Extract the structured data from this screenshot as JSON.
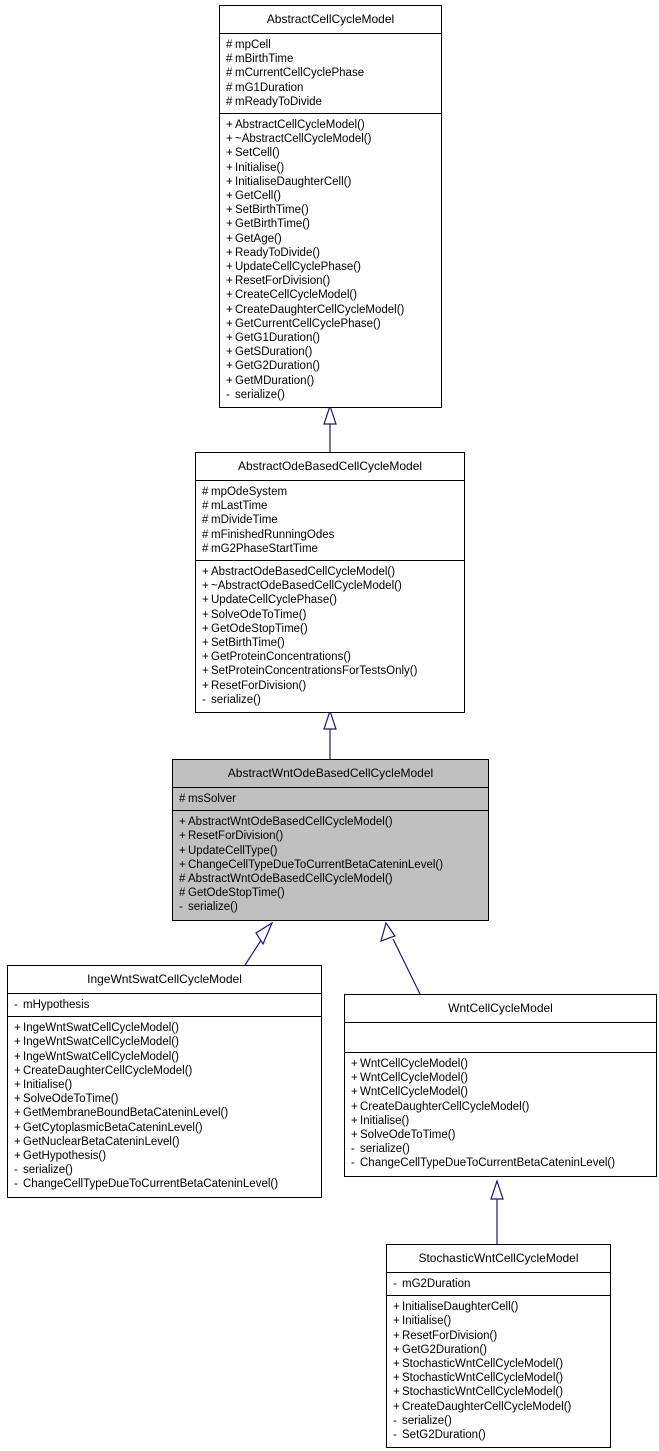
{
  "diagram": {
    "type": "uml-class-diagram",
    "title": "AbstractWntOdeBasedCellCycleModel inheritance diagram",
    "highlight_color": "#c0c0c0",
    "line_color": "#191970",
    "border_color": "#000000",
    "background": "#ffffff"
  },
  "classes": [
    {
      "id": "abstract-cell-cycle-model",
      "name": "AbstractCellCycleModel",
      "highlighted": false,
      "attributes": [
        {
          "vis": "#",
          "label": "mpCell"
        },
        {
          "vis": "#",
          "label": "mBirthTime"
        },
        {
          "vis": "#",
          "label": "mCurrentCellCyclePhase"
        },
        {
          "vis": "#",
          "label": "mG1Duration"
        },
        {
          "vis": "#",
          "label": "mReadyToDivide"
        }
      ],
      "operations": [
        {
          "vis": "+",
          "label": "AbstractCellCycleModel()"
        },
        {
          "vis": "+",
          "label": "~AbstractCellCycleModel()"
        },
        {
          "vis": "+",
          "label": "SetCell()"
        },
        {
          "vis": "+",
          "label": "Initialise()"
        },
        {
          "vis": "+",
          "label": "InitialiseDaughterCell()"
        },
        {
          "vis": "+",
          "label": "GetCell()"
        },
        {
          "vis": "+",
          "label": "SetBirthTime()"
        },
        {
          "vis": "+",
          "label": "GetBirthTime()"
        },
        {
          "vis": "+",
          "label": "GetAge()"
        },
        {
          "vis": "+",
          "label": "ReadyToDivide()"
        },
        {
          "vis": "+",
          "label": "UpdateCellCyclePhase()"
        },
        {
          "vis": "+",
          "label": "ResetForDivision()"
        },
        {
          "vis": "+",
          "label": "CreateCellCycleModel()"
        },
        {
          "vis": "+",
          "label": "CreateDaughterCellCycleModel()"
        },
        {
          "vis": "+",
          "label": "GetCurrentCellCyclePhase()"
        },
        {
          "vis": "+",
          "label": "GetG1Duration()"
        },
        {
          "vis": "+",
          "label": "GetSDuration()"
        },
        {
          "vis": "+",
          "label": "GetG2Duration()"
        },
        {
          "vis": "+",
          "label": "GetMDuration()"
        },
        {
          "vis": "-",
          "label": "serialize()"
        }
      ]
    },
    {
      "id": "abstract-ode-based-cell-cycle-model",
      "name": "AbstractOdeBasedCellCycleModel",
      "highlighted": false,
      "attributes": [
        {
          "vis": "#",
          "label": "mpOdeSystem"
        },
        {
          "vis": "#",
          "label": "mLastTime"
        },
        {
          "vis": "#",
          "label": "mDivideTime"
        },
        {
          "vis": "#",
          "label": "mFinishedRunningOdes"
        },
        {
          "vis": "#",
          "label": "mG2PhaseStartTime"
        }
      ],
      "operations": [
        {
          "vis": "+",
          "label": "AbstractOdeBasedCellCycleModel()"
        },
        {
          "vis": "+",
          "label": "~AbstractOdeBasedCellCycleModel()"
        },
        {
          "vis": "+",
          "label": "UpdateCellCyclePhase()"
        },
        {
          "vis": "+",
          "label": "SolveOdeToTime()"
        },
        {
          "vis": "+",
          "label": "GetOdeStopTime()"
        },
        {
          "vis": "+",
          "label": "SetBirthTime()"
        },
        {
          "vis": "+",
          "label": "GetProteinConcentrations()"
        },
        {
          "vis": "+",
          "label": "SetProteinConcentrationsForTestsOnly()"
        },
        {
          "vis": "+",
          "label": "ResetForDivision()"
        },
        {
          "vis": "-",
          "label": "serialize()"
        }
      ]
    },
    {
      "id": "abstract-wnt-ode-based-cell-cycle-model",
      "name": "AbstractWntOdeBasedCellCycleModel",
      "highlighted": true,
      "attributes": [
        {
          "vis": "#",
          "label": "msSolver"
        }
      ],
      "operations": [
        {
          "vis": "+",
          "label": "AbstractWntOdeBasedCellCycleModel()"
        },
        {
          "vis": "+",
          "label": "ResetForDivision()"
        },
        {
          "vis": "+",
          "label": "UpdateCellType()"
        },
        {
          "vis": "+",
          "label": "ChangeCellTypeDueToCurrentBetaCateninLevel()"
        },
        {
          "vis": "#",
          "label": "AbstractWntOdeBasedCellCycleModel()"
        },
        {
          "vis": "#",
          "label": "GetOdeStopTime()"
        },
        {
          "vis": "-",
          "label": "serialize()"
        }
      ]
    },
    {
      "id": "inge-wnt-swat-cell-cycle-model",
      "name": "IngeWntSwatCellCycleModel",
      "highlighted": false,
      "attributes": [
        {
          "vis": "-",
          "label": "mHypothesis"
        }
      ],
      "operations": [
        {
          "vis": "+",
          "label": "IngeWntSwatCellCycleModel()"
        },
        {
          "vis": "+",
          "label": "IngeWntSwatCellCycleModel()"
        },
        {
          "vis": "+",
          "label": "IngeWntSwatCellCycleModel()"
        },
        {
          "vis": "+",
          "label": "CreateDaughterCellCycleModel()"
        },
        {
          "vis": "+",
          "label": "Initialise()"
        },
        {
          "vis": "+",
          "label": "SolveOdeToTime()"
        },
        {
          "vis": "+",
          "label": "GetMembraneBoundBetaCateninLevel()"
        },
        {
          "vis": "+",
          "label": "GetCytoplasmicBetaCateninLevel()"
        },
        {
          "vis": "+",
          "label": "GetNuclearBetaCateninLevel()"
        },
        {
          "vis": "+",
          "label": "GetHypothesis()"
        },
        {
          "vis": "-",
          "label": "serialize()"
        },
        {
          "vis": "-",
          "label": "ChangeCellTypeDueToCurrentBetaCateninLevel()"
        }
      ]
    },
    {
      "id": "wnt-cell-cycle-model",
      "name": "WntCellCycleModel",
      "highlighted": false,
      "attributes": [],
      "operations": [
        {
          "vis": "+",
          "label": "WntCellCycleModel()"
        },
        {
          "vis": "+",
          "label": "WntCellCycleModel()"
        },
        {
          "vis": "+",
          "label": "WntCellCycleModel()"
        },
        {
          "vis": "+",
          "label": "CreateDaughterCellCycleModel()"
        },
        {
          "vis": "+",
          "label": "Initialise()"
        },
        {
          "vis": "+",
          "label": "SolveOdeToTime()"
        },
        {
          "vis": "-",
          "label": "serialize()"
        },
        {
          "vis": "-",
          "label": "ChangeCellTypeDueToCurrentBetaCateninLevel()"
        }
      ]
    },
    {
      "id": "stochastic-wnt-cell-cycle-model",
      "name": "StochasticWntCellCycleModel",
      "highlighted": false,
      "attributes": [
        {
          "vis": "-",
          "label": "mG2Duration"
        }
      ],
      "operations": [
        {
          "vis": "+",
          "label": "InitialiseDaughterCell()"
        },
        {
          "vis": "+",
          "label": "Initialise()"
        },
        {
          "vis": "+",
          "label": "ResetForDivision()"
        },
        {
          "vis": "+",
          "label": "GetG2Duration()"
        },
        {
          "vis": "+",
          "label": "StochasticWntCellCycleModel()"
        },
        {
          "vis": "+",
          "label": "StochasticWntCellCycleModel()"
        },
        {
          "vis": "+",
          "label": "StochasticWntCellCycleModel()"
        },
        {
          "vis": "+",
          "label": "CreateDaughterCellCycleModel()"
        },
        {
          "vis": "-",
          "label": "serialize()"
        },
        {
          "vis": "-",
          "label": "SetG2Duration()"
        }
      ]
    }
  ],
  "inheritance_edges": [
    {
      "from": "abstract-ode-based-cell-cycle-model",
      "to": "abstract-cell-cycle-model"
    },
    {
      "from": "abstract-wnt-ode-based-cell-cycle-model",
      "to": "abstract-ode-based-cell-cycle-model"
    },
    {
      "from": "inge-wnt-swat-cell-cycle-model",
      "to": "abstract-wnt-ode-based-cell-cycle-model"
    },
    {
      "from": "wnt-cell-cycle-model",
      "to": "abstract-wnt-ode-based-cell-cycle-model"
    },
    {
      "from": "stochastic-wnt-cell-cycle-model",
      "to": "wnt-cell-cycle-model"
    }
  ]
}
